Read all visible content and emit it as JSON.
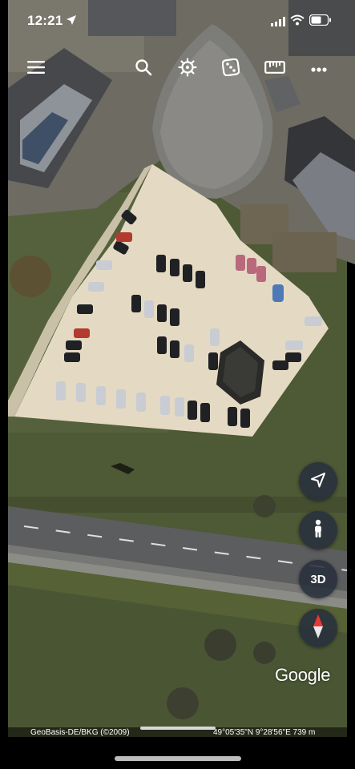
{
  "status_bar": {
    "time": "12:21"
  },
  "toolbar": {
    "items": [
      {
        "icon": "menu-icon"
      },
      {
        "icon": "search-icon"
      },
      {
        "icon": "voyager-wheel-icon"
      },
      {
        "icon": "dice-icon"
      },
      {
        "icon": "ruler-icon"
      },
      {
        "icon": "more-icon"
      }
    ]
  },
  "controls": {
    "three_d_label": "3D"
  },
  "map": {
    "logo": "Google",
    "attribution": "GeoBasis-DE/BKG (©2009)",
    "coordinates": "49°05'35\"N 9°28'56\"E 739 m"
  },
  "colors": {
    "field": "#4f5a37",
    "lot": "#e6dcc5",
    "road": "#5f6061",
    "button_bg": "#28303c"
  }
}
